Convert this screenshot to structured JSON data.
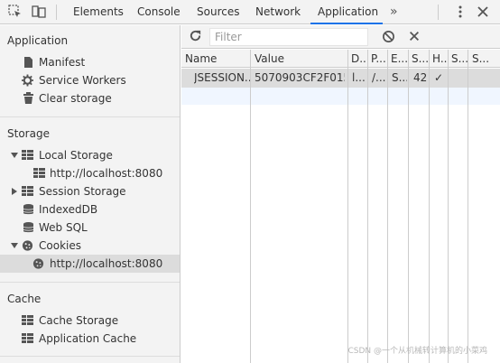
{
  "tabs": [
    {
      "label": "Elements"
    },
    {
      "label": "Console"
    },
    {
      "label": "Sources"
    },
    {
      "label": "Network"
    },
    {
      "label": "Application",
      "active": true
    }
  ],
  "more_tabs": "»",
  "sidebar": {
    "application": {
      "title": "Application",
      "items": [
        {
          "label": "Manifest",
          "icon": "document-icon"
        },
        {
          "label": "Service Workers",
          "icon": "gear-icon"
        },
        {
          "label": "Clear storage",
          "icon": "trash-icon"
        }
      ]
    },
    "storage": {
      "title": "Storage",
      "local_storage": {
        "label": "Local Storage",
        "child": "http://localhost:8080"
      },
      "session_storage": {
        "label": "Session Storage"
      },
      "indexeddb": {
        "label": "IndexedDB"
      },
      "websql": {
        "label": "Web SQL"
      },
      "cookies": {
        "label": "Cookies",
        "child": "http://localhost:8080"
      }
    },
    "cache": {
      "title": "Cache",
      "items": [
        {
          "label": "Cache Storage"
        },
        {
          "label": "Application Cache"
        }
      ]
    }
  },
  "toolbar": {
    "filter_placeholder": "Filter"
  },
  "cookies_table": {
    "columns": [
      "Name",
      "Value",
      "D...",
      "P...",
      "E...",
      "S...",
      "H...",
      "S...",
      "S..."
    ],
    "rows": [
      {
        "name": "JSESSION...",
        "value": "5070903CF2F015...",
        "domain": "l...",
        "path": "/...",
        "expires": "S...",
        "size": "42",
        "http_only": "✓",
        "secure": "",
        "same_site": ""
      }
    ]
  },
  "watermark": "CSDN @一个从机械转计算机的小菜鸡",
  "colors": {
    "accent": "#1a73e8",
    "selected_row": "#dcdcdc",
    "panel_bg": "#f3f3f3"
  }
}
